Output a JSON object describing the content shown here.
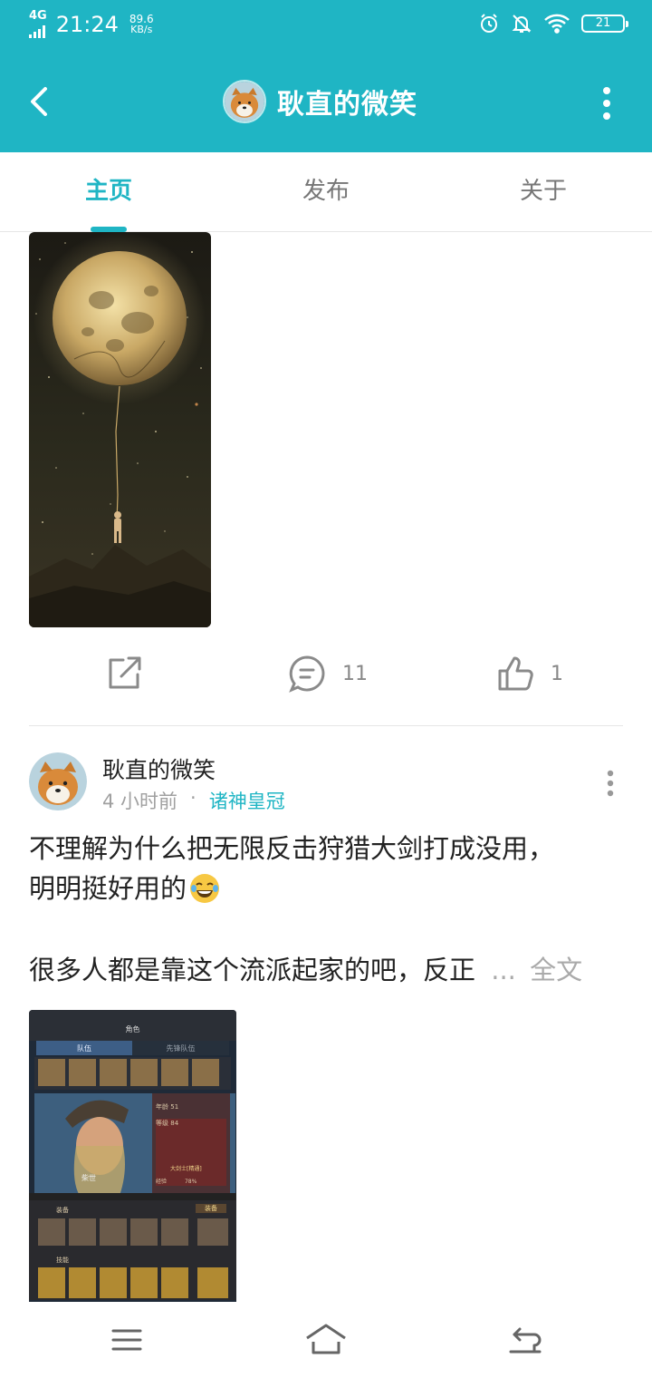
{
  "status_bar": {
    "network": "4G",
    "time": "21:24",
    "speed_value": "89.6",
    "speed_unit": "KB/s",
    "battery": "21"
  },
  "header": {
    "title": "耿直的微笑"
  },
  "tabs": [
    {
      "label": "主页",
      "active": true
    },
    {
      "label": "发布",
      "active": false
    },
    {
      "label": "关于",
      "active": false
    }
  ],
  "post_prev": {
    "comment_count": "11",
    "like_count": "1"
  },
  "post": {
    "author": "耿直的微笑",
    "time": "4 小时前",
    "separator": "·",
    "group": "诸神皇冠",
    "text_line1": "不理解为什么把无限反击狩猎大剑打成没用，",
    "text_line2": "明明挺好用的",
    "text_line3": "很多人都是靠这个流派起家的吧，反正",
    "ellipsis": "...",
    "full_text_label": "全文"
  },
  "game_screenshot": {
    "title": "角色",
    "tab_team": "队伍",
    "tab_vanguard": "先锋队伍",
    "age_label": "年龄",
    "age_value": "51",
    "level_label": "等级",
    "level_value": "84",
    "class_label": "大剑士[精通]",
    "exp_label": "经验",
    "exp_percent": "78%",
    "name": "柴世",
    "equip_label": "装备",
    "skill_label": "技能",
    "equip_button": "装备"
  },
  "colors": {
    "accent": "#1fb5c4",
    "muted": "#a0a0a0"
  },
  "icons": {
    "back": "chevron-left-icon",
    "more": "more-vertical-icon",
    "share": "share-icon",
    "comment": "comment-icon",
    "like": "thumbs-up-icon",
    "menu": "menu-icon",
    "home": "home-icon",
    "return": "return-icon"
  }
}
